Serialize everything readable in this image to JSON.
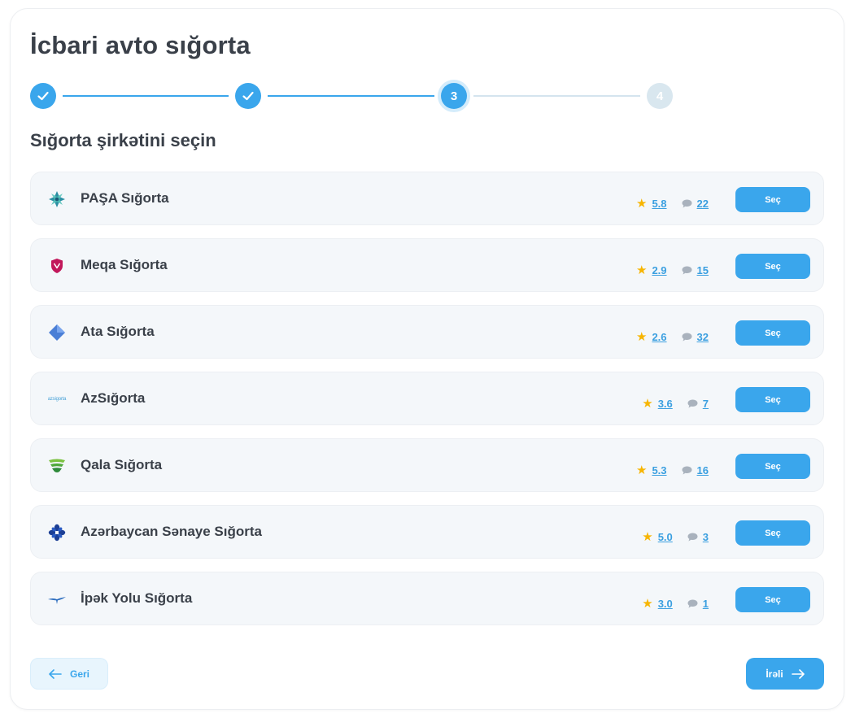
{
  "page": {
    "title": "İcbari avto sığorta",
    "subtitle": "Sığorta şirkətini seçin"
  },
  "stepper": {
    "current_step": 3,
    "total_steps": 4,
    "steps": [
      {
        "label": "",
        "state": "done"
      },
      {
        "label": "",
        "state": "done"
      },
      {
        "label": "3",
        "state": "active"
      },
      {
        "label": "4",
        "state": "pending"
      }
    ]
  },
  "companies": [
    {
      "name": "PAŞA Sığorta",
      "rating": "5.8",
      "reviews": "22",
      "button": "Seç",
      "logo_icon": "pasha-logo-icon"
    },
    {
      "name": "Meqa Sığorta",
      "rating": "2.9",
      "reviews": "15",
      "button": "Seç",
      "logo_icon": "meqa-shield-logo-icon"
    },
    {
      "name": "Ata Sığorta",
      "rating": "2.6",
      "reviews": "32",
      "button": "Seç",
      "logo_icon": "ata-diamond-logo-icon"
    },
    {
      "name": "AzSığorta",
      "rating": "3.6",
      "reviews": "7",
      "button": "Seç",
      "logo_icon": "azsigorta-wordmark-logo-icon",
      "logo_text": "azsigorta"
    },
    {
      "name": "Qala Sığorta",
      "rating": "5.3",
      "reviews": "16",
      "button": "Seç",
      "logo_icon": "qala-logo-icon"
    },
    {
      "name": "Azərbaycan Sənaye Sığorta",
      "rating": "5.0",
      "reviews": "3",
      "button": "Seç",
      "logo_icon": "sanaye-flower-logo-icon"
    },
    {
      "name": "İpək Yolu Sığorta",
      "rating": "3.0",
      "reviews": "1",
      "button": "Seç",
      "logo_icon": "ipek-yolu-bird-logo-icon"
    }
  ],
  "nav": {
    "back_label": "Geri",
    "next_label": "İrəli"
  },
  "colors": {
    "primary": "#3aa6ec",
    "star": "#f7b500",
    "row_bg": "#f4f7fa",
    "text": "#3a4049"
  }
}
